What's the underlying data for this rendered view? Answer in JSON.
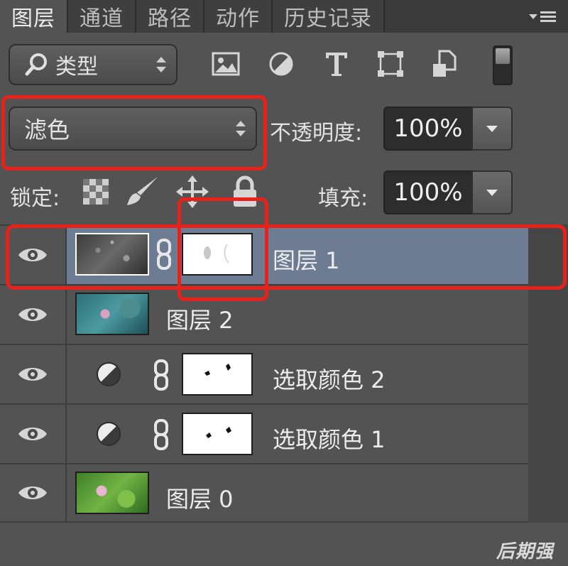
{
  "tabs": [
    {
      "label": "图层",
      "active": true
    },
    {
      "label": "通道",
      "active": false
    },
    {
      "label": "路径",
      "active": false
    },
    {
      "label": "动作",
      "active": false
    },
    {
      "label": "历史记录",
      "active": false
    }
  ],
  "filter": {
    "kind_label": "类型"
  },
  "blend": {
    "mode": "滤色"
  },
  "opacity": {
    "label": "不透明度:",
    "value": "100%"
  },
  "lock": {
    "label": "锁定:"
  },
  "fill": {
    "label": "填充:",
    "value": "100%"
  },
  "layers": [
    {
      "name": "图层 1",
      "selected": true,
      "has_mask": true,
      "kind": "pixel"
    },
    {
      "name": "图层 2",
      "selected": false,
      "has_mask": false,
      "kind": "pixel"
    },
    {
      "name": "选取颜色 2",
      "selected": false,
      "has_mask": true,
      "kind": "adjustment"
    },
    {
      "name": "选取颜色 1",
      "selected": false,
      "has_mask": true,
      "kind": "adjustment"
    },
    {
      "name": "图层 0",
      "selected": false,
      "has_mask": false,
      "kind": "pixel"
    }
  ],
  "watermark": "后期强",
  "colors": {
    "panel": "#535353",
    "selected": "#6d7b93",
    "annotation": "#e8221b"
  },
  "icons": [
    "panel-menu-icon",
    "search-icon",
    "image-filter-icon",
    "adjustment-filter-icon",
    "type-filter-icon",
    "shape-filter-icon",
    "smart-object-filter-icon",
    "lock-transparent-icon",
    "lock-image-icon",
    "lock-position-icon",
    "lock-all-icon",
    "eye-icon",
    "link-chain-icon",
    "adjustment-layer-icon"
  ]
}
